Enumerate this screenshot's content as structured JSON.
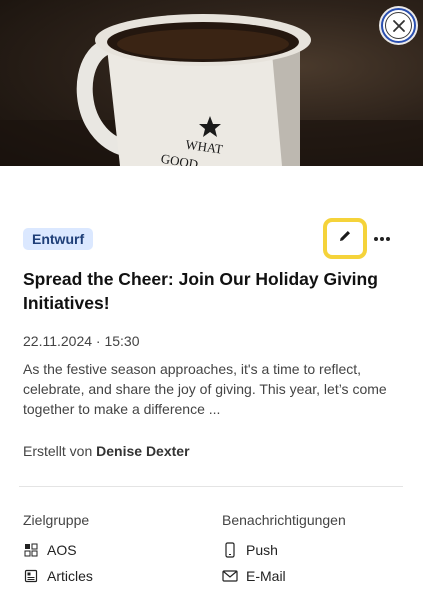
{
  "hero": {
    "mug_text": "WHAT",
    "mug_text2": "GOOD"
  },
  "status_badge": "Entwurf",
  "title": "Spread the Cheer: Join Our Holiday Giving Initiatives!",
  "datetime": "22.11.2024 · 15:30",
  "description": "As the festive season approaches, it's a time to reflect, celebrate, and share the joy of giving. This year, let’s come together to make a difference ...",
  "author": {
    "prefix": "Erstellt von",
    "name": "Denise Dexter"
  },
  "audience": {
    "heading": "Zielgruppe",
    "items": [
      {
        "label": "AOS",
        "icon": "grid-icon"
      },
      {
        "label": "Articles",
        "icon": "article-icon"
      }
    ]
  },
  "notifications": {
    "heading": "Benachrichtigungen",
    "items": [
      {
        "label": "Push",
        "icon": "phone-icon"
      },
      {
        "label": "E-Mail",
        "icon": "mail-icon"
      }
    ]
  },
  "colors": {
    "accent_highlight": "#f5d33a",
    "badge_bg": "#dbe8ff",
    "badge_text": "#1f3f78"
  }
}
